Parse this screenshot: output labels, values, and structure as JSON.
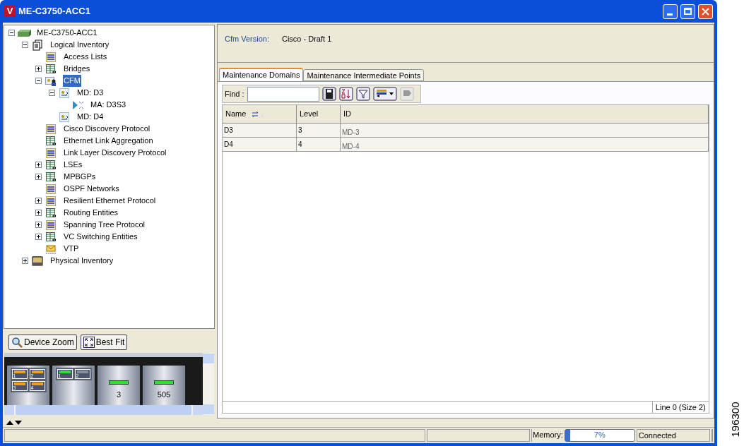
{
  "window": {
    "title": "ME-C3750-ACC1",
    "logo": "V"
  },
  "tree": [
    {
      "label": "ME-C3750-ACC1",
      "kind": "device",
      "expanded": true,
      "selected": false,
      "children": [
        {
          "label": "Logical Inventory",
          "kind": "logical",
          "expanded": true,
          "selected": false,
          "children": [
            {
              "label": "Access Lists",
              "kind": "list",
              "selected": false
            },
            {
              "label": "Bridges",
              "kind": "table",
              "expanded": false,
              "selected": false
            },
            {
              "label": "CFM",
              "kind": "cfm",
              "expanded": true,
              "selected": true,
              "children": [
                {
                  "label": "MD: D3",
                  "kind": "md",
                  "expanded": true,
                  "selected": false,
                  "children": [
                    {
                      "label": "MA: D3S3",
                      "kind": "ma",
                      "selected": false
                    }
                  ]
                },
                {
                  "label": "MD: D4",
                  "kind": "md",
                  "selected": false
                }
              ]
            },
            {
              "label": "Cisco Discovery Protocol",
              "kind": "list",
              "selected": false
            },
            {
              "label": "Ethernet Link Aggregation",
              "kind": "table",
              "selected": false
            },
            {
              "label": "Link Layer Discovery Protocol",
              "kind": "list",
              "selected": false
            },
            {
              "label": "LSEs",
              "kind": "table",
              "expanded": false,
              "selected": false
            },
            {
              "label": "MPBGPs",
              "kind": "table",
              "expanded": false,
              "selected": false
            },
            {
              "label": "OSPF Networks",
              "kind": "list",
              "selected": false
            },
            {
              "label": "Resilient Ethernet Protocol",
              "kind": "list",
              "expanded": false,
              "selected": false
            },
            {
              "label": "Routing Entities",
              "kind": "table",
              "expanded": false,
              "selected": false
            },
            {
              "label": "Spanning Tree Protocol",
              "kind": "list",
              "expanded": false,
              "selected": false
            },
            {
              "label": "VC Switching Entities",
              "kind": "table",
              "expanded": false,
              "selected": false
            },
            {
              "label": "VTP",
              "kind": "vtp",
              "selected": false
            }
          ]
        },
        {
          "label": "Physical Inventory",
          "kind": "physical",
          "expanded": false,
          "selected": false
        }
      ]
    }
  ],
  "device_toolbar": [
    {
      "label": "Device Zoom",
      "kind": "zoom"
    },
    {
      "label": "Best Fit",
      "kind": "fit"
    }
  ],
  "device_view": {
    "slots": [
      {
        "ports": [
          {
            "label": "1",
            "kind": "orange"
          },
          {
            "label": "2",
            "kind": "orange"
          },
          {
            "label": "3",
            "kind": "orange"
          },
          {
            "label": "4",
            "kind": "orange"
          }
        ]
      },
      {
        "ports": [
          {
            "label": "1",
            "kind": "green"
          },
          {
            "label": "2",
            "kind": "empty"
          }
        ]
      },
      {
        "label": "3"
      },
      {
        "label": "505"
      }
    ]
  },
  "properties": [
    {
      "label": "Cfm Version:",
      "value": "Cisco - Draft 1"
    }
  ],
  "tabs": [
    {
      "label": "Maintenance Domains",
      "selected": true
    },
    {
      "label": "Maintenance Intermediate Points",
      "selected": false
    }
  ],
  "find": {
    "label": "Find :"
  },
  "table": {
    "columns": [
      "Name",
      "Level",
      "ID"
    ],
    "rows": [
      [
        "D3",
        "3",
        "MD-3"
      ],
      [
        "D4",
        "4",
        "MD-4"
      ]
    ],
    "footer": "Line 0 (Size 2)"
  },
  "status_bar": {
    "memory_label": "Memory:",
    "memory": {
      "level": 0.07,
      "reading": "7%"
    },
    "connection": "Connected"
  },
  "figure_id": "196300"
}
